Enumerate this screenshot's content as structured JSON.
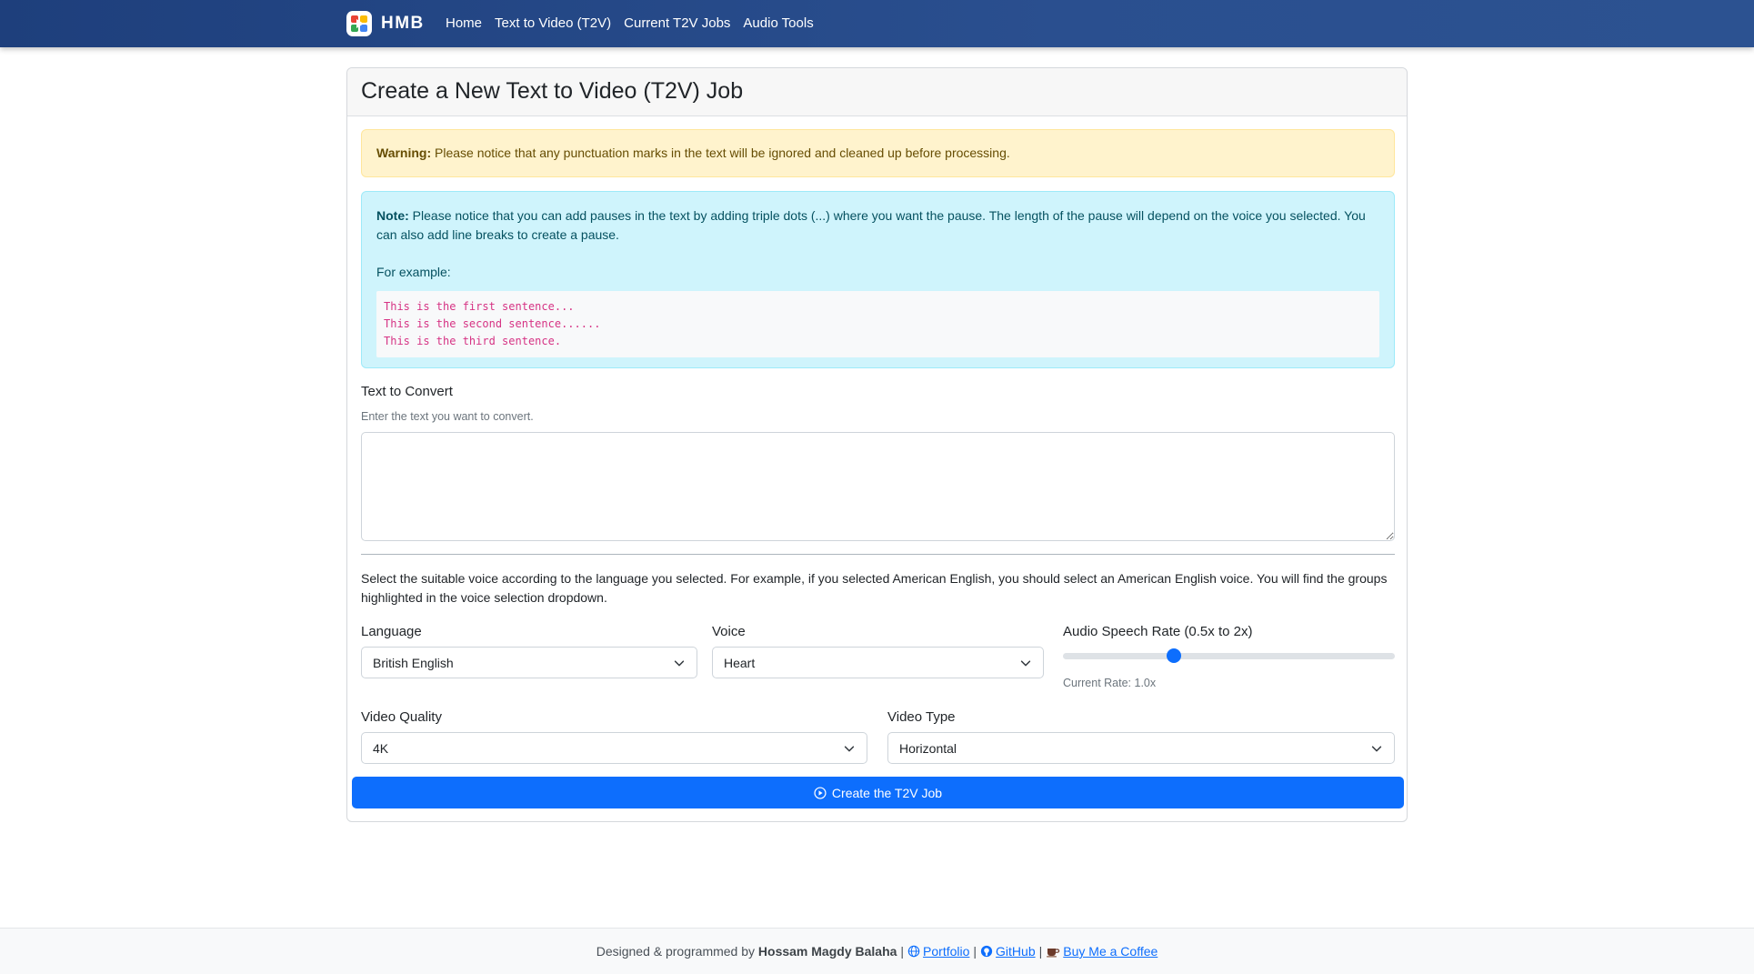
{
  "nav": {
    "brand": "HMB",
    "links": [
      "Home",
      "Text to Video (T2V)",
      "Current T2V Jobs",
      "Audio Tools"
    ]
  },
  "card": {
    "title": "Create a New Text to Video (T2V) Job"
  },
  "warning": {
    "label": "Warning:",
    "text": "Please notice that any punctuation marks in the text will be ignored and cleaned up before processing."
  },
  "note": {
    "label": "Note:",
    "text": "Please notice that you can add pauses in the text by adding triple dots (...) where you want the pause. The length of the pause will depend on the voice you selected. You can also add line breaks to create a pause.",
    "example_label": "For example:",
    "example_lines": [
      "This is the first sentence...",
      "This is the second sentence......",
      "This is the third sentence."
    ]
  },
  "text_input": {
    "label": "Text to Convert",
    "help": "Enter the text you want to convert.",
    "value": ""
  },
  "voice_description": "Select the suitable voice according to the language you selected. For example, if you selected American English, you should select an American English voice. You will find the groups highlighted in the voice selection dropdown.",
  "language": {
    "label": "Language",
    "selected": "British English"
  },
  "voice": {
    "label": "Voice",
    "selected": "Heart"
  },
  "rate": {
    "label": "Audio Speech Rate (0.5x to 2x)",
    "min": 0.5,
    "max": 2,
    "value": 1.0,
    "current_text": "Current Rate: 1.0x"
  },
  "video_quality": {
    "label": "Video Quality",
    "selected": "4K"
  },
  "video_type": {
    "label": "Video Type",
    "selected": "Horizontal"
  },
  "submit_label": "Create the T2V Job",
  "footer": {
    "prefix": "Designed & programmed by",
    "author": "Hossam Magdy Balaha",
    "portfolio": "Portfolio",
    "github": "GitHub",
    "coffee": "Buy Me a Coffee",
    "separator": "|"
  },
  "colors": {
    "navbar": "#1e3f7c",
    "primary": "#0d6efd",
    "warning_bg": "#fff3cd",
    "info_bg": "#cff4fc",
    "code": "#d63384"
  }
}
